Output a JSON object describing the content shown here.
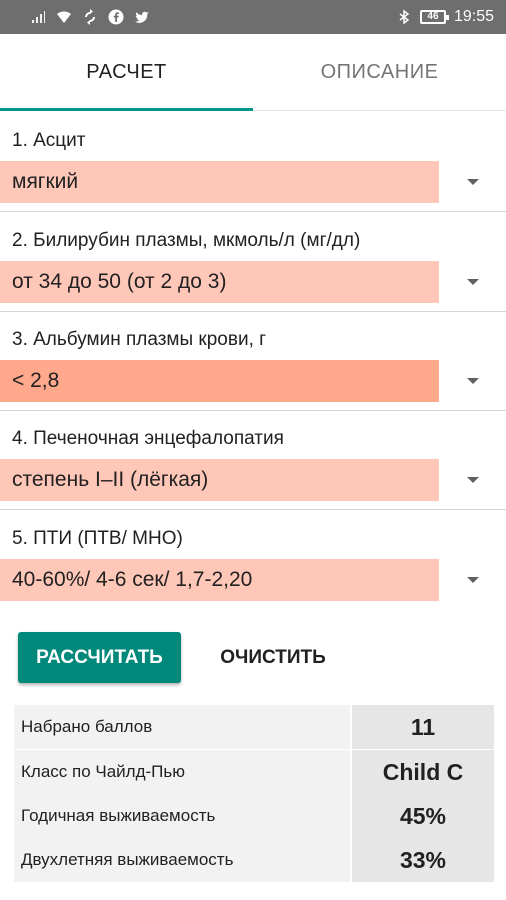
{
  "status_bar": {
    "left_icons": [
      "signal-icon",
      "wifi-icon",
      "sync-icon",
      "facebook-icon",
      "twitter-icon"
    ],
    "right_icons": [
      "bluetooth-icon",
      "battery-icon"
    ],
    "battery_level": "46",
    "time": "19:55"
  },
  "tabs": [
    {
      "label": "РАСЧЕТ",
      "active": true
    },
    {
      "label": "ОПИСАНИЕ",
      "active": false
    }
  ],
  "fields": [
    {
      "label": "1. Асцит",
      "value": "мягкий"
    },
    {
      "label": "2. Билирубин плазмы, мкмоль/л (мг/дл)",
      "value": "от 34 до 50 (от 2 до 3)"
    },
    {
      "label": "3. Альбумин плазмы крови, г",
      "value": "< 2,8"
    },
    {
      "label": "4. Печеночная энцефалопатия",
      "value": "степень I–II (лёгкая)"
    },
    {
      "label": "5. ПТИ (ПТВ/ МНО)",
      "value": "40-60%/ 4-6 сек/ 1,7-2,20"
    }
  ],
  "actions": {
    "calculate": "РАССЧИТАТЬ",
    "clear": "ОЧИСТИТЬ"
  },
  "results": [
    {
      "label": "Набрано баллов",
      "value": "11"
    },
    {
      "label": "Класс по Чайлд-Пью",
      "value": "Child C"
    },
    {
      "label": "Годичная выживаемость",
      "value": "45%"
    },
    {
      "label": "Двухлетняя выживаемость",
      "value": "33%"
    }
  ],
  "colors": {
    "accent": "#009688",
    "button": "#00897b",
    "select_bg": "#ffc7b8",
    "select_bg_strong": "#ffa88c",
    "status_bar": "#6e6e6e"
  }
}
